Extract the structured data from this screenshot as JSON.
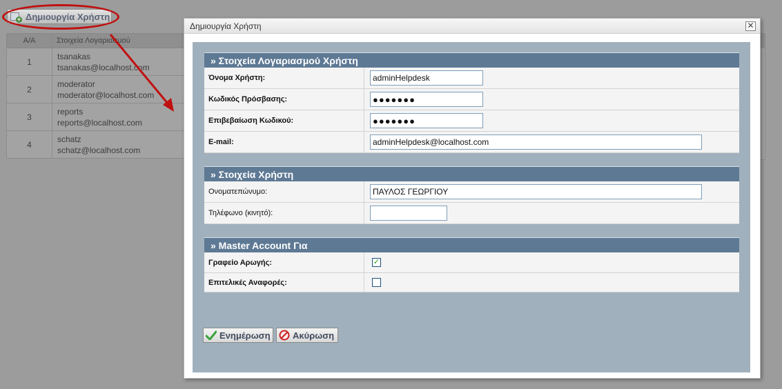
{
  "background": {
    "toolbar": {
      "create_user_label": "Δημιουργία Χρήστη"
    },
    "table": {
      "headers": [
        "Α/Α",
        "Στοιχεία Λογαριασμού"
      ],
      "rows": [
        {
          "num": "1",
          "username": "tsanakas",
          "email": "tsanakas@localhost.com"
        },
        {
          "num": "2",
          "username": "moderator",
          "email": "moderator@localhost.com"
        },
        {
          "num": "3",
          "username": "reports",
          "email": "reports@localhost.com"
        },
        {
          "num": "4",
          "username": "schatz",
          "email": "schatz@localhost.com"
        }
      ]
    },
    "annotation_color": "#c01010"
  },
  "dialog": {
    "title": "Δημιουργία Χρήστη",
    "close_icon": "close-icon",
    "account_section": {
      "header": "» Στοιχεία Λογαριασμού Χρήστη",
      "username_label": "Όνομα Χρήστη:",
      "username_value": "adminHelpdesk",
      "password_label": "Κωδικός Πρόσβασης:",
      "password_value": "●●●●●●●",
      "confirm_label": "Επιβεβαίωση Κωδικού:",
      "confirm_value": "●●●●●●●",
      "email_label": "E-mail:",
      "email_value": "adminHelpdesk@localhost.com"
    },
    "user_section": {
      "header": "» Στοιχεία Χρήστη",
      "fullname_label": "Ονοματεπώνυμο:",
      "fullname_value": "ΠΑΥΛΟΣ ΓΕΩΡΓΙΟΥ",
      "phone_label": "Τηλέφωνο (κινητό):",
      "phone_value": ""
    },
    "master_section": {
      "header": "» Master Account Για",
      "helpdesk_label": "Γραφείο Αρωγής:",
      "helpdesk_checked": true,
      "reports_label": "Επιτελικές Αναφορές:",
      "reports_checked": false
    },
    "buttons": {
      "update_label": "Ενημέρωση",
      "cancel_label": "Ακύρωση"
    },
    "colors": {
      "section_header": "#5e7994",
      "body_bg": "#a0b0bd"
    }
  }
}
